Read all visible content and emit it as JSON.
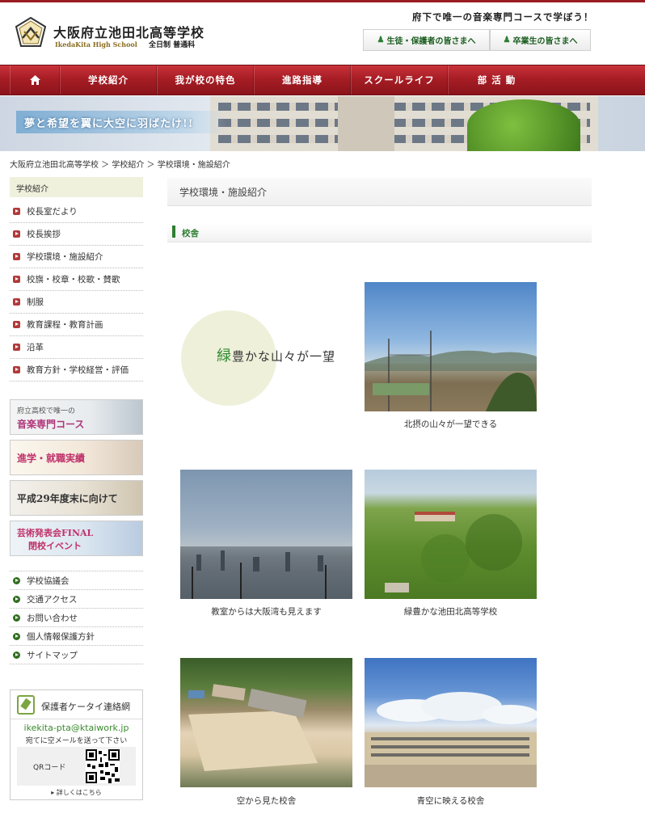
{
  "header": {
    "school_name": "大阪府立池田北高等学校",
    "school_name_en": "IkedaKita High School",
    "course": "全日制 普通科",
    "tagline": "府下で唯一の音楽専門コースで学ぼう！",
    "btn_students": "生徒・保護者の皆さまへ",
    "btn_alumni": "卒業生の皆さまへ"
  },
  "nav": {
    "items": [
      "学校紹介",
      "我が校の特色",
      "進路指導",
      "スクールライフ",
      "部 活 動"
    ]
  },
  "banner": {
    "caption": "夢と希望を翼に大空に羽ばたけ!!"
  },
  "breadcrumb": "大阪府立池田北高等学校 ＞ 学校紹介 ＞ 学校環境・施設紹介",
  "sidebar": {
    "heading": "学校紹介",
    "items": [
      "校長室だより",
      "校長挨拶",
      "学校環境・施設紹介",
      "校旗・校章・校歌・賛歌",
      "制服",
      "教育課程・教育計画",
      "沿革",
      "教育方針・学校経営・評価"
    ],
    "banners": {
      "music_line1": "府立高校で唯一の",
      "music_line2": "音楽専門コース",
      "career": "進学・就職実績",
      "h29": "平成29年度末に向けて",
      "art_line1": "芸術発表会FINAL",
      "art_line2": "閉校イベント"
    },
    "links": [
      "学校協議会",
      "交通アクセス",
      "お問い合わせ",
      "個人情報保護方針",
      "サイトマップ"
    ],
    "mobile": {
      "title": "保護者ケータイ連絡網",
      "email": "ikekita-pta@ktaiwork.jp",
      "note": "宛てに空メールを送って下さい",
      "qr_label": "QRコード",
      "more": "▸ 詳しくはこちら"
    }
  },
  "main": {
    "page_title": "学校環境・施設紹介",
    "section_title": "校舎",
    "slogan_green": "緑",
    "slogan_rest": "豊かな山々が一望",
    "captions": [
      "北摂の山々が一望できる",
      "教室からは大阪湾も見えます",
      "緑豊かな池田北高等学校",
      "空から見た校舎",
      "青空に映える校舎"
    ]
  },
  "colors": {
    "nav_red": "#a81d25",
    "accent_green": "#2e7d32",
    "sidebar_bullet": "#b23a3a"
  }
}
